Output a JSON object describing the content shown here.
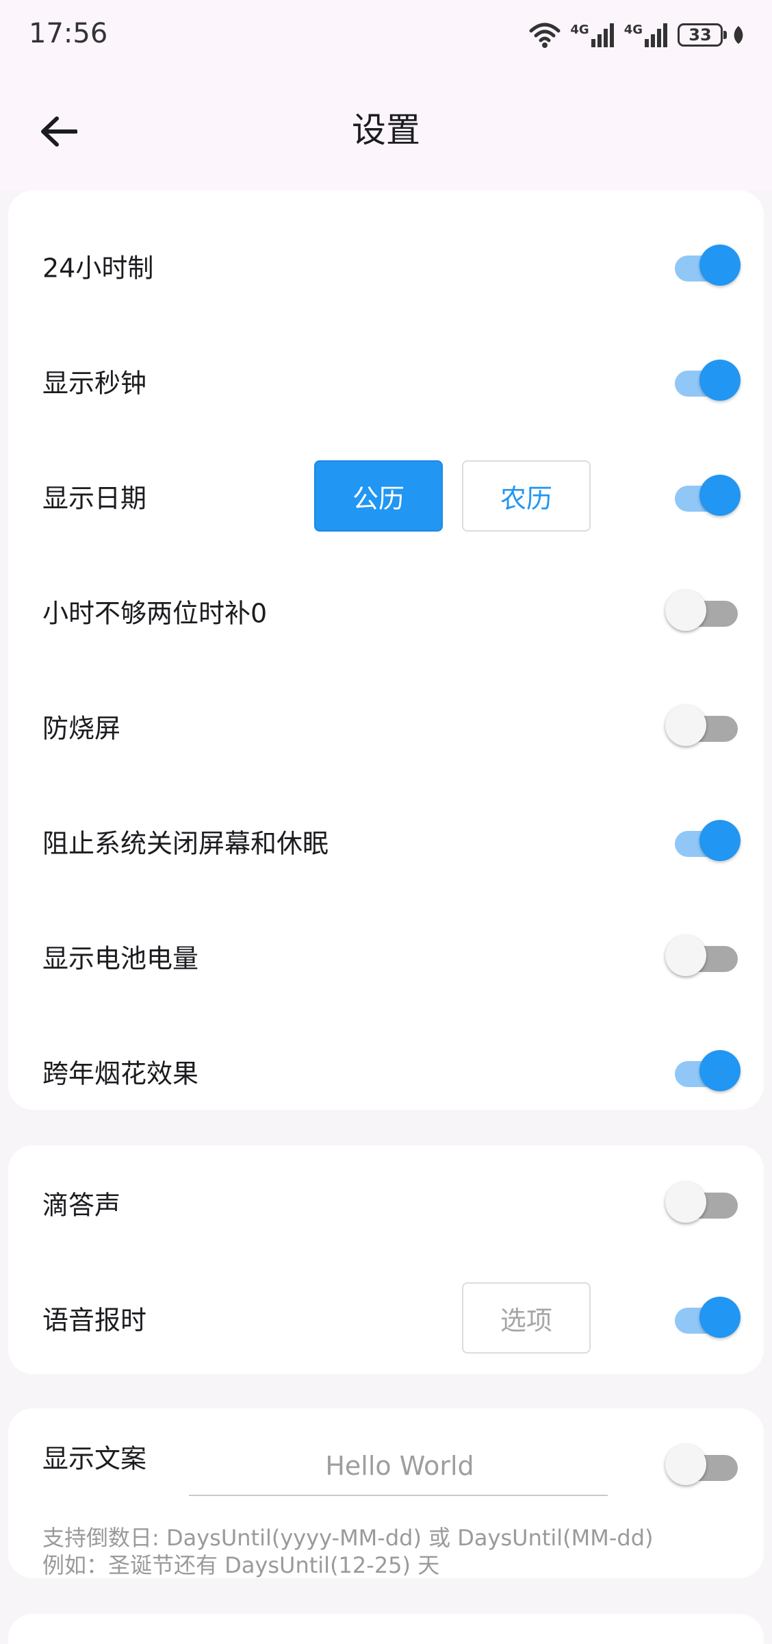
{
  "status_bar": {
    "time": "17:56",
    "battery": "33",
    "network_label": "4G",
    "icons": [
      "wifi-icon",
      "signal-icon",
      "signal-icon",
      "battery-icon",
      "leaf-icon"
    ]
  },
  "app_bar": {
    "back_icon": "arrow-left-icon",
    "title": "设置"
  },
  "colors": {
    "accent": "#2196f3",
    "track_on": "#90c7f6",
    "track_off": "#a8a8a8",
    "background": "#f7f5f8",
    "card": "#ffffff"
  },
  "card1": {
    "rows": [
      {
        "label": "24小时制",
        "on": true
      },
      {
        "label": "显示秒钟",
        "on": true
      },
      {
        "label": "显示日期",
        "on": true,
        "options": [
          "公历",
          "农历"
        ],
        "selected": "公历"
      },
      {
        "label": "小时不够两位时补0",
        "on": false
      },
      {
        "label": "防烧屏",
        "on": false
      },
      {
        "label": "阻止系统关闭屏幕和休眠",
        "on": true
      },
      {
        "label": "显示电池电量",
        "on": false
      },
      {
        "label": "跨年烟花效果",
        "on": true
      }
    ]
  },
  "card2": {
    "rows": [
      {
        "label": "滴答声",
        "on": false
      },
      {
        "label": "语音报时",
        "on": true,
        "button": "选项"
      }
    ]
  },
  "card3": {
    "label": "显示文案",
    "on": false,
    "placeholder": "Hello World",
    "hint1": "支持倒数日: DaysUntil(yyyy-MM-dd) 或 DaysUntil(MM-dd)",
    "hint2": "例如：圣诞节还有 DaysUntil(12-25) 天"
  }
}
